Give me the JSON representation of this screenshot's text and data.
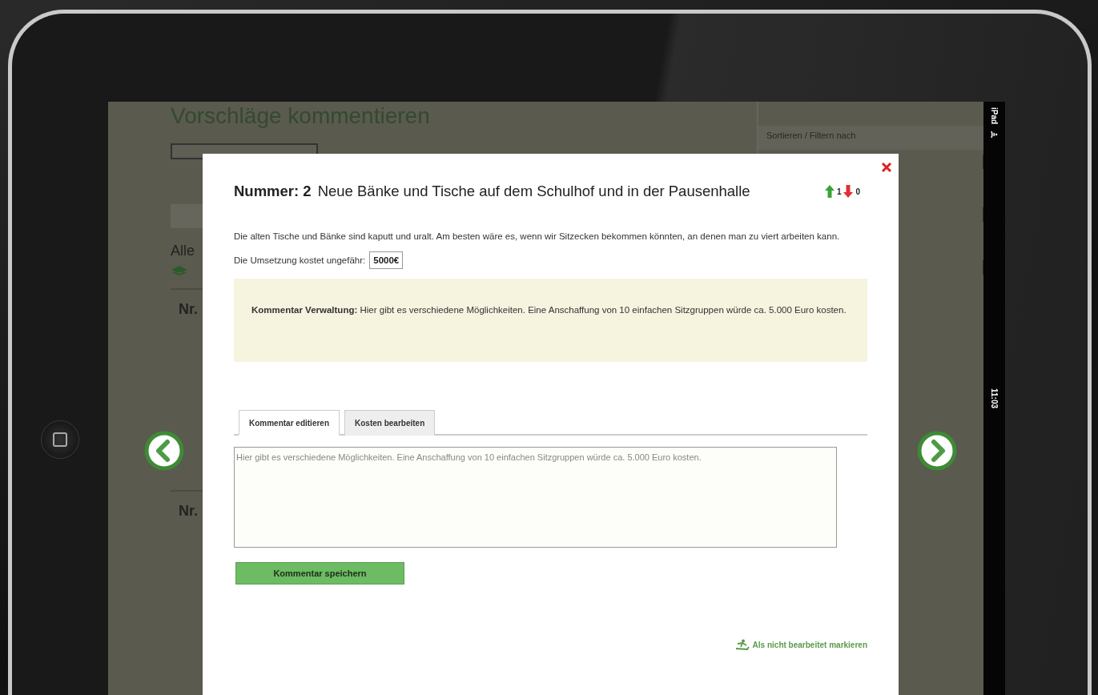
{
  "background": {
    "title": "Vorschläge kommentieren",
    "sort_label": "Sortieren / Filtern nach",
    "heading": "Alle",
    "items": [
      {
        "label": "Nr."
      },
      {
        "label": "Nr."
      }
    ]
  },
  "status_bar": {
    "device": "iPad",
    "time": "11:03"
  },
  "dialog": {
    "number": "Nummer: 2",
    "title": "Neue Bänke und Tische auf dem Schulhof und in der Pausenhalle",
    "votes_up": "1",
    "votes_down": "0",
    "description": "Die alten Tische und Bänke sind kaputt und uralt. Am besten wäre es, wenn wir Sitzecken bekommen könnten, an denen man zu viert arbeiten kann.",
    "cost_label": "Die Umsetzung kostet ungefähr:",
    "cost": "5000€",
    "admin_comment": "**Kommentar Verwaltung:** Hier gibt es verschiedene Möglichkeiten. Eine Anschaffung von 10 einfachen Sitzgruppen würde ca. 5.000 Euro kosten.",
    "tabs": [
      {
        "label": "Kommentar editieren",
        "selected": true
      },
      {
        "label": "Kosten bearbeiten",
        "selected": false
      }
    ],
    "comment_value": "Hier gibt es verschiedene Möglichkeiten. Eine Anschaffung von 10 einfachen Sitzgruppen würde ca. 5.000 Euro kosten.",
    "save_button": "Kommentar speichern",
    "mark_link": "Als nicht bearbeitet markieren"
  }
}
